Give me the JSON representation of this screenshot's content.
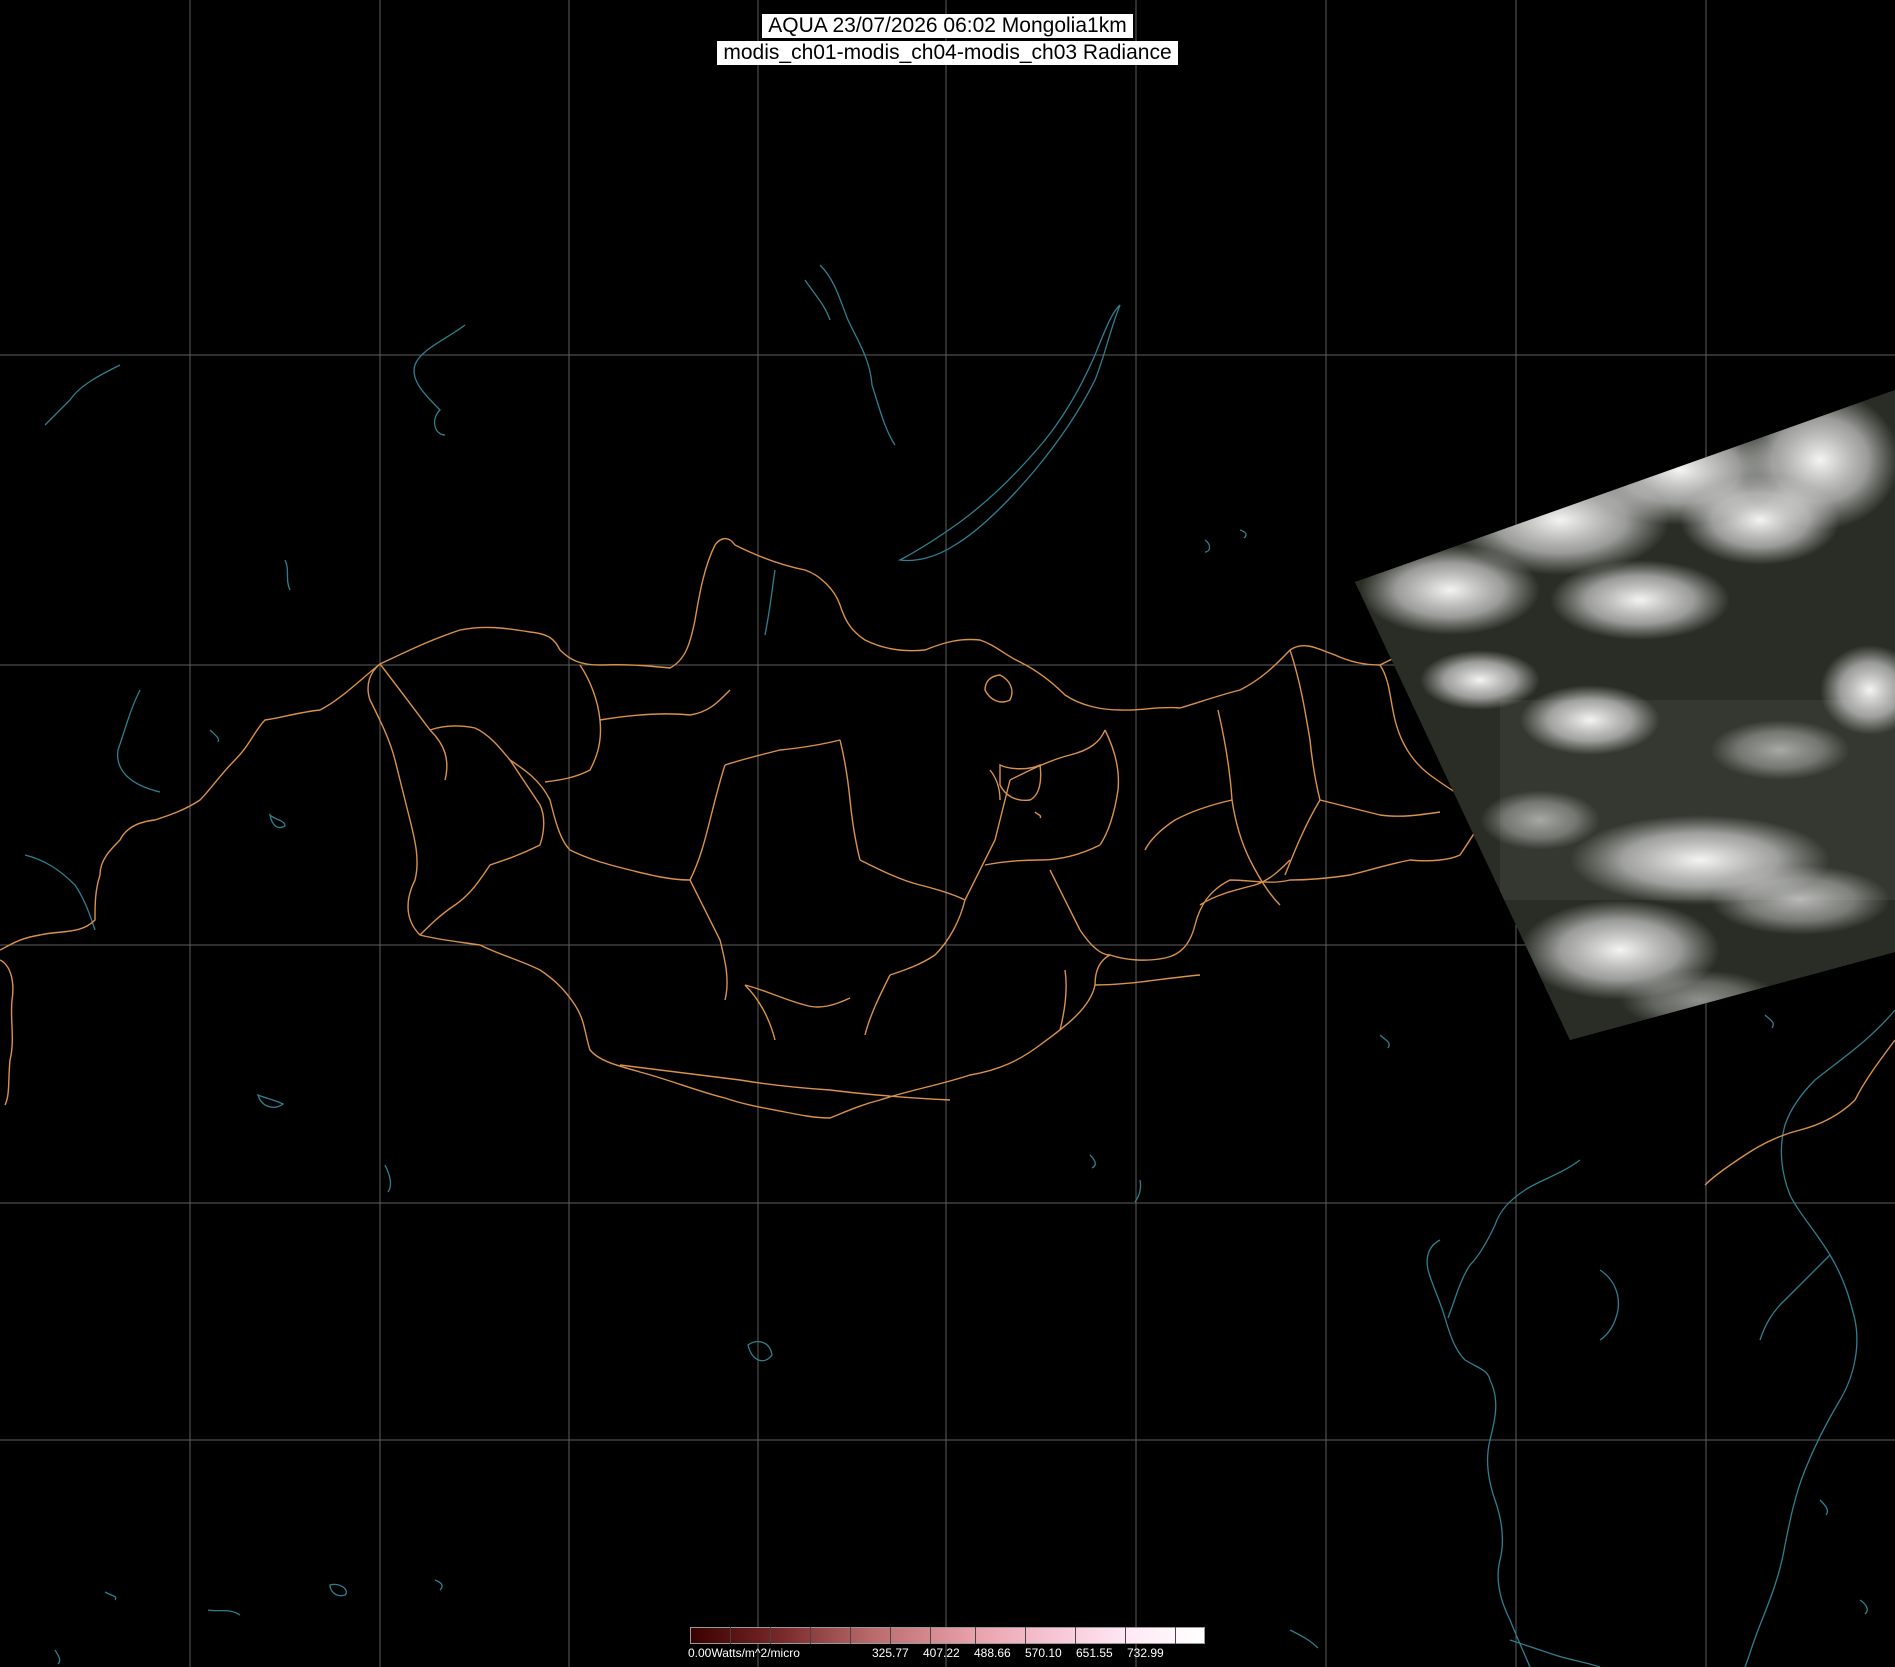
{
  "header": {
    "line1": "AQUA 23/07/2026 06:02 Mongolia1km",
    "line2": "modis_ch01-modis_ch04-modis_ch03 Radiance"
  },
  "colorbar": {
    "labels": [
      "0.00Watts/m^2/micro",
      "325.77",
      "407.22",
      "488.66",
      "570.10",
      "651.55",
      "732.99"
    ]
  },
  "colors": {
    "background": "#000000",
    "graticule": "#6a6a6a",
    "borders": "#d9924a",
    "coastline": "#2f7f8f",
    "title_bg": "#ffffff"
  },
  "layers": {
    "graticule": "grid",
    "admin_borders": "orange",
    "coastlines": "teal",
    "satellite_swath": "cloud imagery"
  }
}
